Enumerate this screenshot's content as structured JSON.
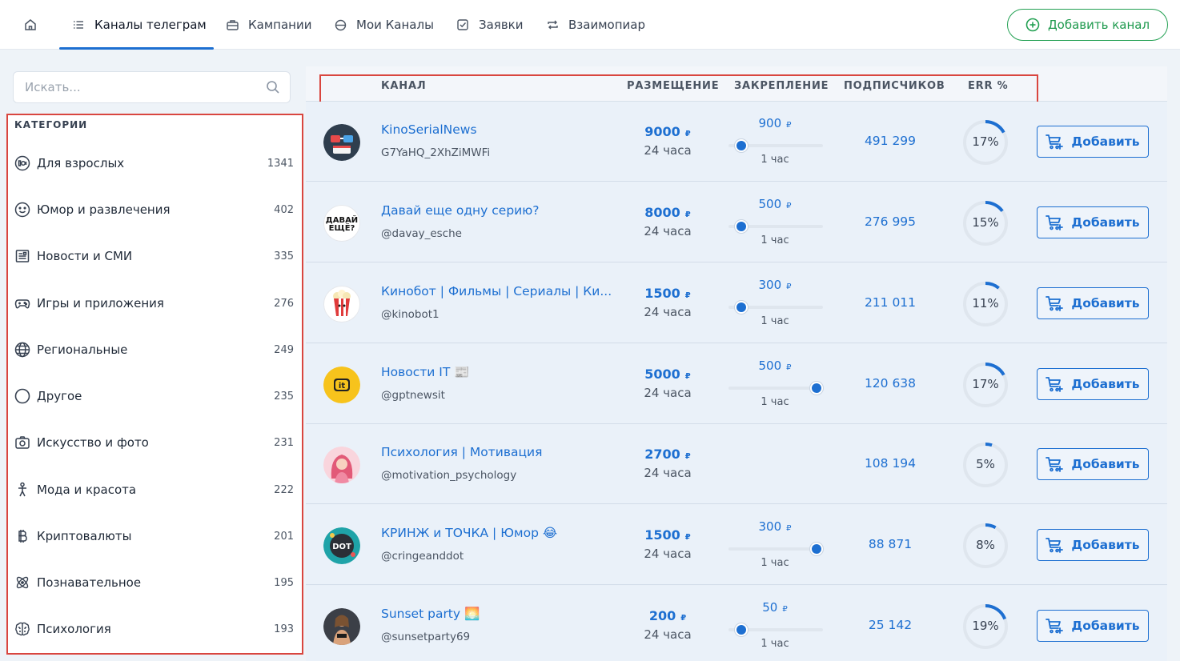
{
  "nav": {
    "items": [
      {
        "label": "Каналы телеграм",
        "icon": "list-icon"
      },
      {
        "label": "Кампании",
        "icon": "briefcase-icon"
      },
      {
        "label": "Мои Каналы",
        "icon": "globe-icon"
      },
      {
        "label": "Заявки",
        "icon": "checkbox-icon"
      },
      {
        "label": "Взаимопиар",
        "icon": "repeat-icon"
      }
    ],
    "add_channel_label": "Добавить канал"
  },
  "search": {
    "placeholder": "Искать..."
  },
  "categories": {
    "title": "КАТЕГОРИИ",
    "items": [
      {
        "name": "Для взрослых",
        "count": "1341",
        "icon": "adult-icon"
      },
      {
        "name": "Юмор и развлечения",
        "count": "402",
        "icon": "smile-icon"
      },
      {
        "name": "Новости и СМИ",
        "count": "335",
        "icon": "news-icon"
      },
      {
        "name": "Игры и приложения",
        "count": "276",
        "icon": "gamepad-icon"
      },
      {
        "name": "Региональные",
        "count": "249",
        "icon": "globe-icon"
      },
      {
        "name": "Другое",
        "count": "235",
        "icon": "circle-icon"
      },
      {
        "name": "Искусство и фото",
        "count": "231",
        "icon": "camera-icon"
      },
      {
        "name": "Мода и красота",
        "count": "222",
        "icon": "person-icon"
      },
      {
        "name": "Криптовалюты",
        "count": "201",
        "icon": "bitcoin-icon"
      },
      {
        "name": "Познавательное",
        "count": "195",
        "icon": "atom-icon"
      },
      {
        "name": "Психология",
        "count": "193",
        "icon": "brain-icon"
      }
    ]
  },
  "table": {
    "headers": {
      "channel": "КАНАЛ",
      "placement": "РАЗМЕЩЕНИЕ",
      "pin": "ЗАКРЕПЛЕНИЕ",
      "subscribers": "ПОДПИСЧИКОВ",
      "err": "ERR %"
    },
    "currency": "₽",
    "add_label": "Добавить",
    "rows": [
      {
        "name": "KinoSerialNews",
        "handle": "G7YaHQ_2XhZiMWFi",
        "price": "9000",
        "period": "24 часа",
        "pin_price": "900",
        "pin_period": "1 час",
        "pin_level": 0,
        "subscribers": "491 299",
        "err": "17%",
        "err_value": 17,
        "avatar_color": "#2f3e4e",
        "avatar_icon": "glasses-icon"
      },
      {
        "name": "Давай еще одну серию?",
        "handle": "@davay_esche",
        "price": "8000",
        "period": "24 часа",
        "pin_price": "500",
        "pin_period": "1 час",
        "pin_level": 0,
        "subscribers": "276 995",
        "err": "15%",
        "err_value": 15,
        "avatar_color": "#ffffff",
        "avatar_icon": "text-logo-icon",
        "avatar_text": "ДАВАЙ ЕЩЁ?"
      },
      {
        "name": "Кинобот | Фильмы | Сериалы | Ки...",
        "handle": "@kinobot1",
        "price": "1500",
        "period": "24 часа",
        "pin_price": "300",
        "pin_period": "1 час",
        "pin_level": 0,
        "subscribers": "211 011",
        "err": "11%",
        "err_value": 11,
        "avatar_color": "#ffffff",
        "avatar_icon": "popcorn-icon"
      },
      {
        "name": "Новости IT 📰",
        "handle": "@gptnewsit",
        "price": "5000",
        "period": "24 часа",
        "pin_price": "500",
        "pin_period": "1 час",
        "pin_level": 1,
        "subscribers": "120 638",
        "err": "17%",
        "err_value": 17,
        "avatar_color": "#f7c31c",
        "avatar_icon": "it-icon",
        "avatar_text": "it"
      },
      {
        "name": "Психология | Мотивация",
        "handle": "@motivation_psychology",
        "price": "2700",
        "period": "24 часа",
        "pin_price": "",
        "pin_period": "",
        "pin_level": null,
        "subscribers": "108 194",
        "err": "5%",
        "err_value": 5,
        "avatar_color": "#f9d5dd",
        "avatar_icon": "girl-icon"
      },
      {
        "name": "КРИНЖ и ТОЧКА | Юмор 😂",
        "handle": "@cringeanddot",
        "price": "1500",
        "period": "24 часа",
        "pin_price": "300",
        "pin_period": "1 час",
        "pin_level": 1,
        "subscribers": "88 871",
        "err": "8%",
        "err_value": 8,
        "avatar_color": "#1fa3a8",
        "avatar_icon": "dot-logo-icon",
        "avatar_text": "DOT"
      },
      {
        "name": "Sunset party 🌅",
        "handle": "@sunsetparty69",
        "price": "200",
        "period": "24 часа",
        "pin_price": "50",
        "pin_period": "1 час",
        "pin_level": 0,
        "subscribers": "25 142",
        "err": "19%",
        "err_value": 19,
        "avatar_color": "#3b3f47",
        "avatar_icon": "photo-icon"
      }
    ]
  },
  "colors": {
    "accent": "#1d6fd1",
    "green": "#22a052",
    "highlight": "#d9463f"
  }
}
